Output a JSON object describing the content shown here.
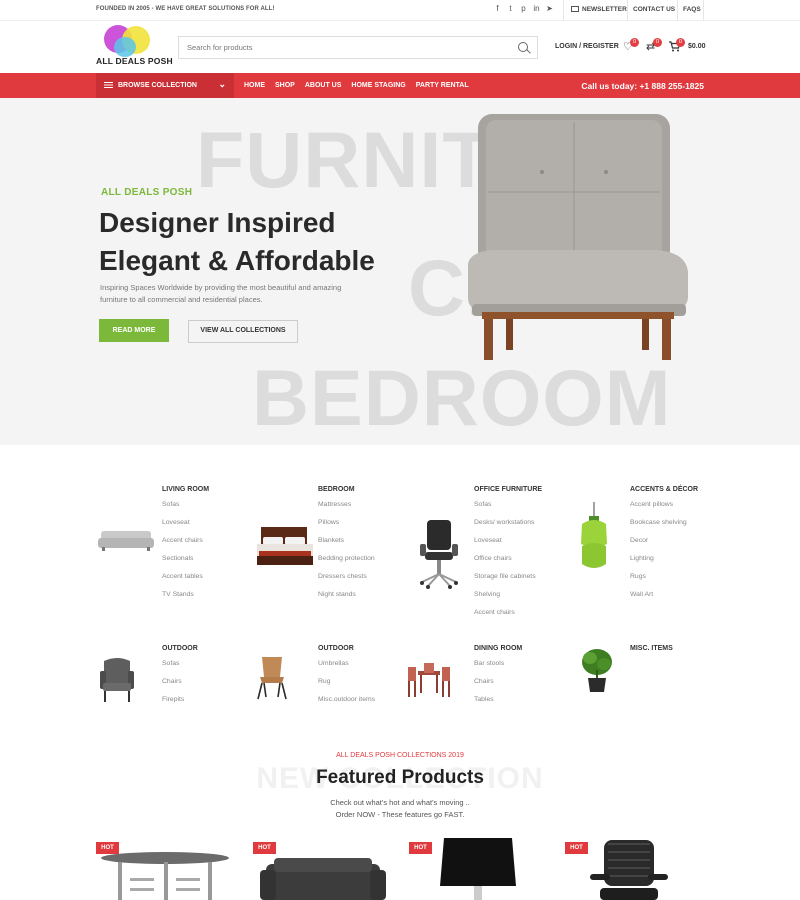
{
  "topbar": {
    "founded": "FOUNDED IN 2005 - WE HAVE GREAT SOLUTIONS FOR ALL!",
    "social_icons": [
      "facebook-icon",
      "twitter-icon",
      "pinterest-icon",
      "linkedin-icon",
      "telegram-icon"
    ],
    "social_glyphs": [
      "f",
      "t",
      "p",
      "in",
      "➤"
    ],
    "newsletter": "NEWSLETTER",
    "contact": "CONTACT US",
    "faqs": "FAQS"
  },
  "header": {
    "logo_text": "ALL DEALS POSH",
    "search_placeholder": "Search for products",
    "login": "LOGIN / REGISTER",
    "wishlist_count": "0",
    "compare_count": "0",
    "cart_count": "0",
    "cart_total": "$0.00"
  },
  "nav": {
    "browse": "BROWSE COLLECTION",
    "items": [
      "HOME",
      "SHOP",
      "ABOUT US",
      "HOME STAGING",
      "PARTY RENTAL"
    ],
    "call": "Call us today: +1 888 255-1825"
  },
  "hero": {
    "bg_words": [
      "FURNITURE",
      "CHAIR",
      "BEDROOM"
    ],
    "eyebrow": "ALL DEALS POSH",
    "headline_1": "Designer Inspired",
    "headline_2": "Elegant & Affordable",
    "subtext": "Inspiring Spaces Worldwide by providing the most beautiful and amazing furniture to all commercial and residential places.",
    "read_more": "READ MORE",
    "view_all": "VIEW ALL COLLECTIONS"
  },
  "categories": [
    {
      "title": "LIVING ROOM",
      "items": [
        "Sofas",
        "Loveseat",
        "Accent chairs",
        "Sectionals",
        "Accent tables",
        "TV Stands"
      ]
    },
    {
      "title": "BEDROOM",
      "items": [
        "Mattresses",
        "Pillows",
        "Blankets",
        "Bedding protection",
        "Dressers chests",
        "Night stands"
      ]
    },
    {
      "title": "OFFICE FURNITURE",
      "items": [
        "Sofas",
        "Desks/ workstations",
        "Loveseat",
        "Office chairs",
        "Storage file cabinets",
        "Shelving",
        "Accent chairs"
      ]
    },
    {
      "title": "ACCENTS & DÉCOR",
      "items": [
        "Accent pillows",
        "Bookcase shelving",
        "Decor",
        "Lighting",
        "Rugs",
        "Wall Art"
      ]
    },
    {
      "title": "OUTDOOR",
      "items": [
        "Sofas",
        "Chairs",
        "Firepits"
      ]
    },
    {
      "title": "OUTDOOR",
      "items": [
        "Umbrellas",
        "Rug",
        "Misc.outdoor items"
      ]
    },
    {
      "title": "DINING ROOM",
      "items": [
        "Bar stools",
        "Chairs",
        "Tables"
      ]
    },
    {
      "title": "MISC. ITEMS",
      "items": []
    }
  ],
  "featured": {
    "eyebrow": "ALL DEALS POSH COLLECTIONS 2019",
    "ghost": "NEW COLLECTION",
    "title": "Featured Products",
    "sub_1": "Check out what's hot and what's moving ..",
    "sub_2": "Order NOW - These features go FAST.",
    "badge": "HOT"
  },
  "colors": {
    "accent_red": "#e03a3e",
    "accent_green": "#7cb83a"
  }
}
